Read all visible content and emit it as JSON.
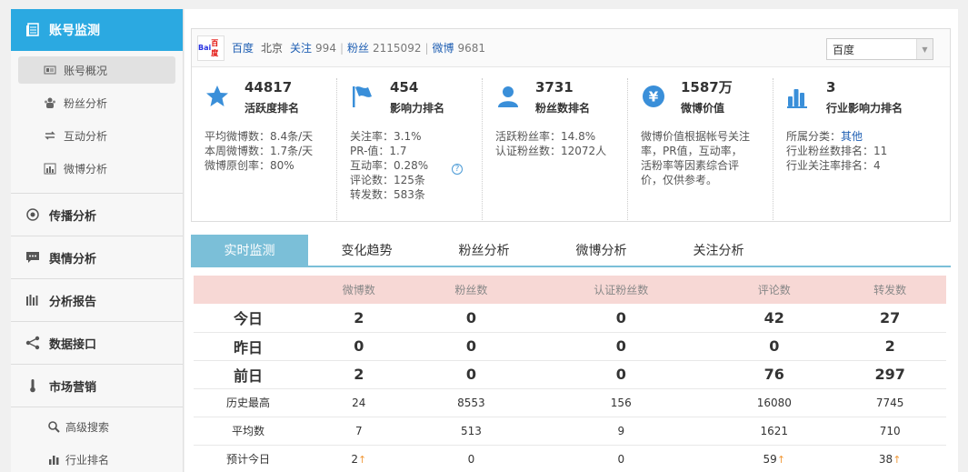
{
  "sidebar": {
    "top_label": "账号监测",
    "sub_items": [
      {
        "label": "账号概况",
        "icon": "id-card-icon"
      },
      {
        "label": "粉丝分析",
        "icon": "people-icon"
      },
      {
        "label": "互动分析",
        "icon": "exchange-icon"
      },
      {
        "label": "微博分析",
        "icon": "chart-icon"
      }
    ],
    "sections": [
      {
        "label": "传播分析",
        "icon": "target-icon"
      },
      {
        "label": "舆情分析",
        "icon": "chat-icon"
      },
      {
        "label": "分析报告",
        "icon": "bars-icon"
      },
      {
        "label": "数据接口",
        "icon": "share-icon"
      },
      {
        "label": "市场营销",
        "icon": "thermometer-icon"
      }
    ],
    "market_items": [
      {
        "label": "高级搜索",
        "icon": "search-icon"
      },
      {
        "label": "行业排名",
        "icon": "bar-chart-icon"
      }
    ]
  },
  "account": {
    "logo_text_1": "Bai",
    "logo_text_2": "百度",
    "name": "百度",
    "location": "北京",
    "follow_label": "关注",
    "follow_count": "994",
    "fans_label": "粉丝",
    "fans_count": "2115092",
    "weibo_label": "微博",
    "weibo_count": "9681",
    "select_value": "百度"
  },
  "stats": [
    {
      "number": "44817",
      "label": "活跃度排名",
      "lines": [
        "平均微博数：8.4条/天",
        "本周微博数：1.7条/天",
        "微博原创率：80%"
      ]
    },
    {
      "number": "454",
      "label": "影响力排名",
      "lines": [
        "关注率：3.1%",
        " PR-值：1.7",
        "互动率：0.28%",
        "评论数：125条",
        "转发数：583条"
      ],
      "help": "?"
    },
    {
      "number": "3731",
      "label": "粉丝数排名",
      "lines": [
        "活跃粉丝率：14.8%",
        "认证粉丝数：12072人"
      ]
    },
    {
      "number": "1587万",
      "label": "微博价值",
      "lines": [
        "微博价值根据帐号关注",
        "率，PR值，互动率，",
        "活粉率等因素综合评",
        "价，仅供参考。"
      ]
    },
    {
      "number": "3",
      "label": "行业影响力排名",
      "category_prefix": "所属分类：",
      "category": "其他",
      "lines": [
        "行业粉丝数排名：11",
        "行业关注率排名：4"
      ]
    }
  ],
  "tabs": [
    "实时监测",
    "变化趋势",
    "粉丝分析",
    "微博分析",
    "关注分析"
  ],
  "table": {
    "headers": [
      "",
      "微博数",
      "粉丝数",
      "认证粉丝数",
      "评论数",
      "转发数"
    ],
    "rows": [
      {
        "label": "今日",
        "cells": [
          "2",
          "0",
          "0",
          "42",
          "27"
        ]
      },
      {
        "label": "昨日",
        "cells": [
          "0",
          "0",
          "0",
          "0",
          "2"
        ]
      },
      {
        "label": "前日",
        "cells": [
          "2",
          "0",
          "0",
          "76",
          "297"
        ]
      },
      {
        "label": "历史最高",
        "cells": [
          "24",
          "8553",
          "156",
          "16080",
          "7745"
        ]
      },
      {
        "label": "平均数",
        "cells": [
          "7",
          "513",
          "9",
          "1621",
          "710"
        ]
      },
      {
        "label": "预计今日",
        "cells": [
          "2",
          "0",
          "0",
          "59",
          "38"
        ],
        "up_marks": [
          "↑",
          "",
          "",
          "↑",
          "↑"
        ]
      }
    ]
  },
  "colors": {
    "sidebar_active": "#2ba9e1",
    "tab_active": "#7bbfd8",
    "table_header": "#f7d8d5",
    "icon_blue": "#3a8fd9",
    "link": "#1f5fb3",
    "up_arrow": "#f19b3c"
  }
}
